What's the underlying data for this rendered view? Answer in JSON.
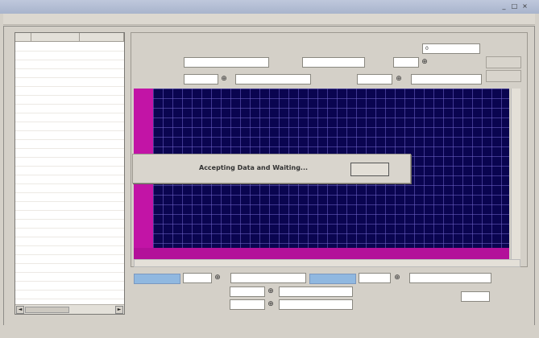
{
  "window": {
    "title": "",
    "controls": {
      "minimize": "_",
      "maximize": "□",
      "close": "×"
    }
  },
  "menu": {
    "items": [
      "",
      "",
      ""
    ]
  },
  "list": {
    "columns": [
      "",
      "",
      ""
    ],
    "scroll_left": "◄",
    "scroll_right": "►"
  },
  "group": {
    "title": ""
  },
  "timestamp": "",
  "fields": {
    "row1": {
      "value1": "",
      "value2": "",
      "value3": "",
      "value4": "0",
      "value5": ""
    },
    "row2": {
      "value1": "",
      "value2": "",
      "value3": "",
      "value4": "",
      "value5": ""
    }
  },
  "plot": {
    "y_ticks": [
      "",
      "",
      "",
      "",
      "",
      ""
    ],
    "background_color": "#0a0550",
    "axis_color": "#c214a6"
  },
  "dialog": {
    "message": "Accepting Data and Waiting...",
    "cancel_label": ""
  },
  "bottom": {
    "row1": {
      "value1": "",
      "value2": "",
      "value3": "",
      "value4": ""
    },
    "row2": {
      "value1": "",
      "value2": ""
    },
    "row3": {
      "value1": "",
      "value2": "",
      "value3": ""
    }
  },
  "icons": {
    "spin": "spin-icon",
    "dropdown": "dropdown-icon"
  }
}
